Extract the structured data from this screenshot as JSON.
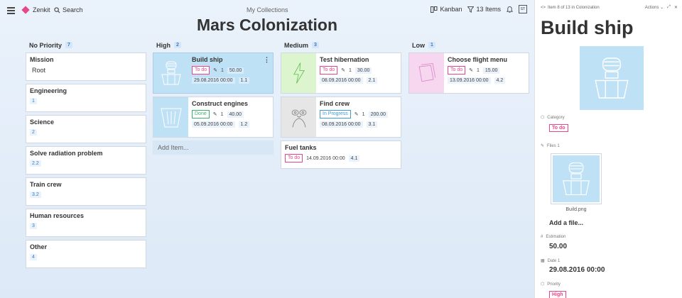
{
  "topbar": {
    "brand": "Zenkit",
    "search_label": "Search",
    "breadcrumb": "My Collections",
    "view_label": "Kanban",
    "items_label": "13 Items",
    "user_initials": "ST"
  },
  "page_title": "Mars Colonization",
  "columns": [
    {
      "name": "No Priority",
      "count": "7",
      "groups": [
        {
          "title": "Mission",
          "sub": "Root"
        },
        {
          "title": "Engineering",
          "sub": "1"
        },
        {
          "title": "Science",
          "sub": "2"
        },
        {
          "title": "Solve radiation problem",
          "sub": "2.2"
        },
        {
          "title": "Train crew",
          "sub": "3.2"
        },
        {
          "title": "Human resources",
          "sub": "3"
        },
        {
          "title": "Other",
          "sub": "4"
        }
      ]
    },
    {
      "name": "High",
      "count": "2",
      "cards": [
        {
          "title": "Build ship",
          "status": "To do",
          "files": "1",
          "estimation": "50.00",
          "date": "29.08.2016 00:00",
          "code": "1.1"
        },
        {
          "title": "Construct engines",
          "status": "Done",
          "files": "1",
          "estimation": "40.00",
          "date": "05.09.2016 00:00",
          "code": "1.2"
        }
      ],
      "add_item": "Add Item..."
    },
    {
      "name": "Medium",
      "count": "3",
      "cards": [
        {
          "title": "Test hibernation",
          "status": "To do",
          "files": "1",
          "estimation": "30.00",
          "date": "08.09.2016 00:00",
          "code": "2.1"
        },
        {
          "title": "Find crew",
          "status": "In Progress",
          "files": "1",
          "estimation": "200.00",
          "date": "08.09.2016 00:00",
          "code": "3.1"
        },
        {
          "title": "Fuel tanks",
          "status": "To do",
          "date": "14.09.2016 00:00",
          "code": "4.1"
        }
      ]
    },
    {
      "name": "Low",
      "count": "1",
      "cards": [
        {
          "title": "Choose flight menu",
          "status": "To do",
          "files": "1",
          "estimation": "15.00",
          "date": "13.09.2016 00:00",
          "code": "4.2"
        }
      ]
    }
  ],
  "panel": {
    "nav_text": "Item 8 of 13 in Colonization",
    "actions_label": "Actions",
    "title": "Build ship",
    "category_label": "Category",
    "category_value": "To do",
    "files_label": "Files 1",
    "file_name": "Build.png",
    "add_file": "Add a file...",
    "estimation_label": "Estimation",
    "estimation_value": "50.00",
    "date_label": "Date 1",
    "date_value": "29.08.2016 00:00",
    "priority_label": "Priority",
    "priority_value": "High"
  },
  "colors": {
    "accent": "#3a7bc8",
    "todo": "#e8468a",
    "done": "#3ab26d",
    "in_progress": "#3a9bd6",
    "selected_card": "#bfe1f6"
  }
}
